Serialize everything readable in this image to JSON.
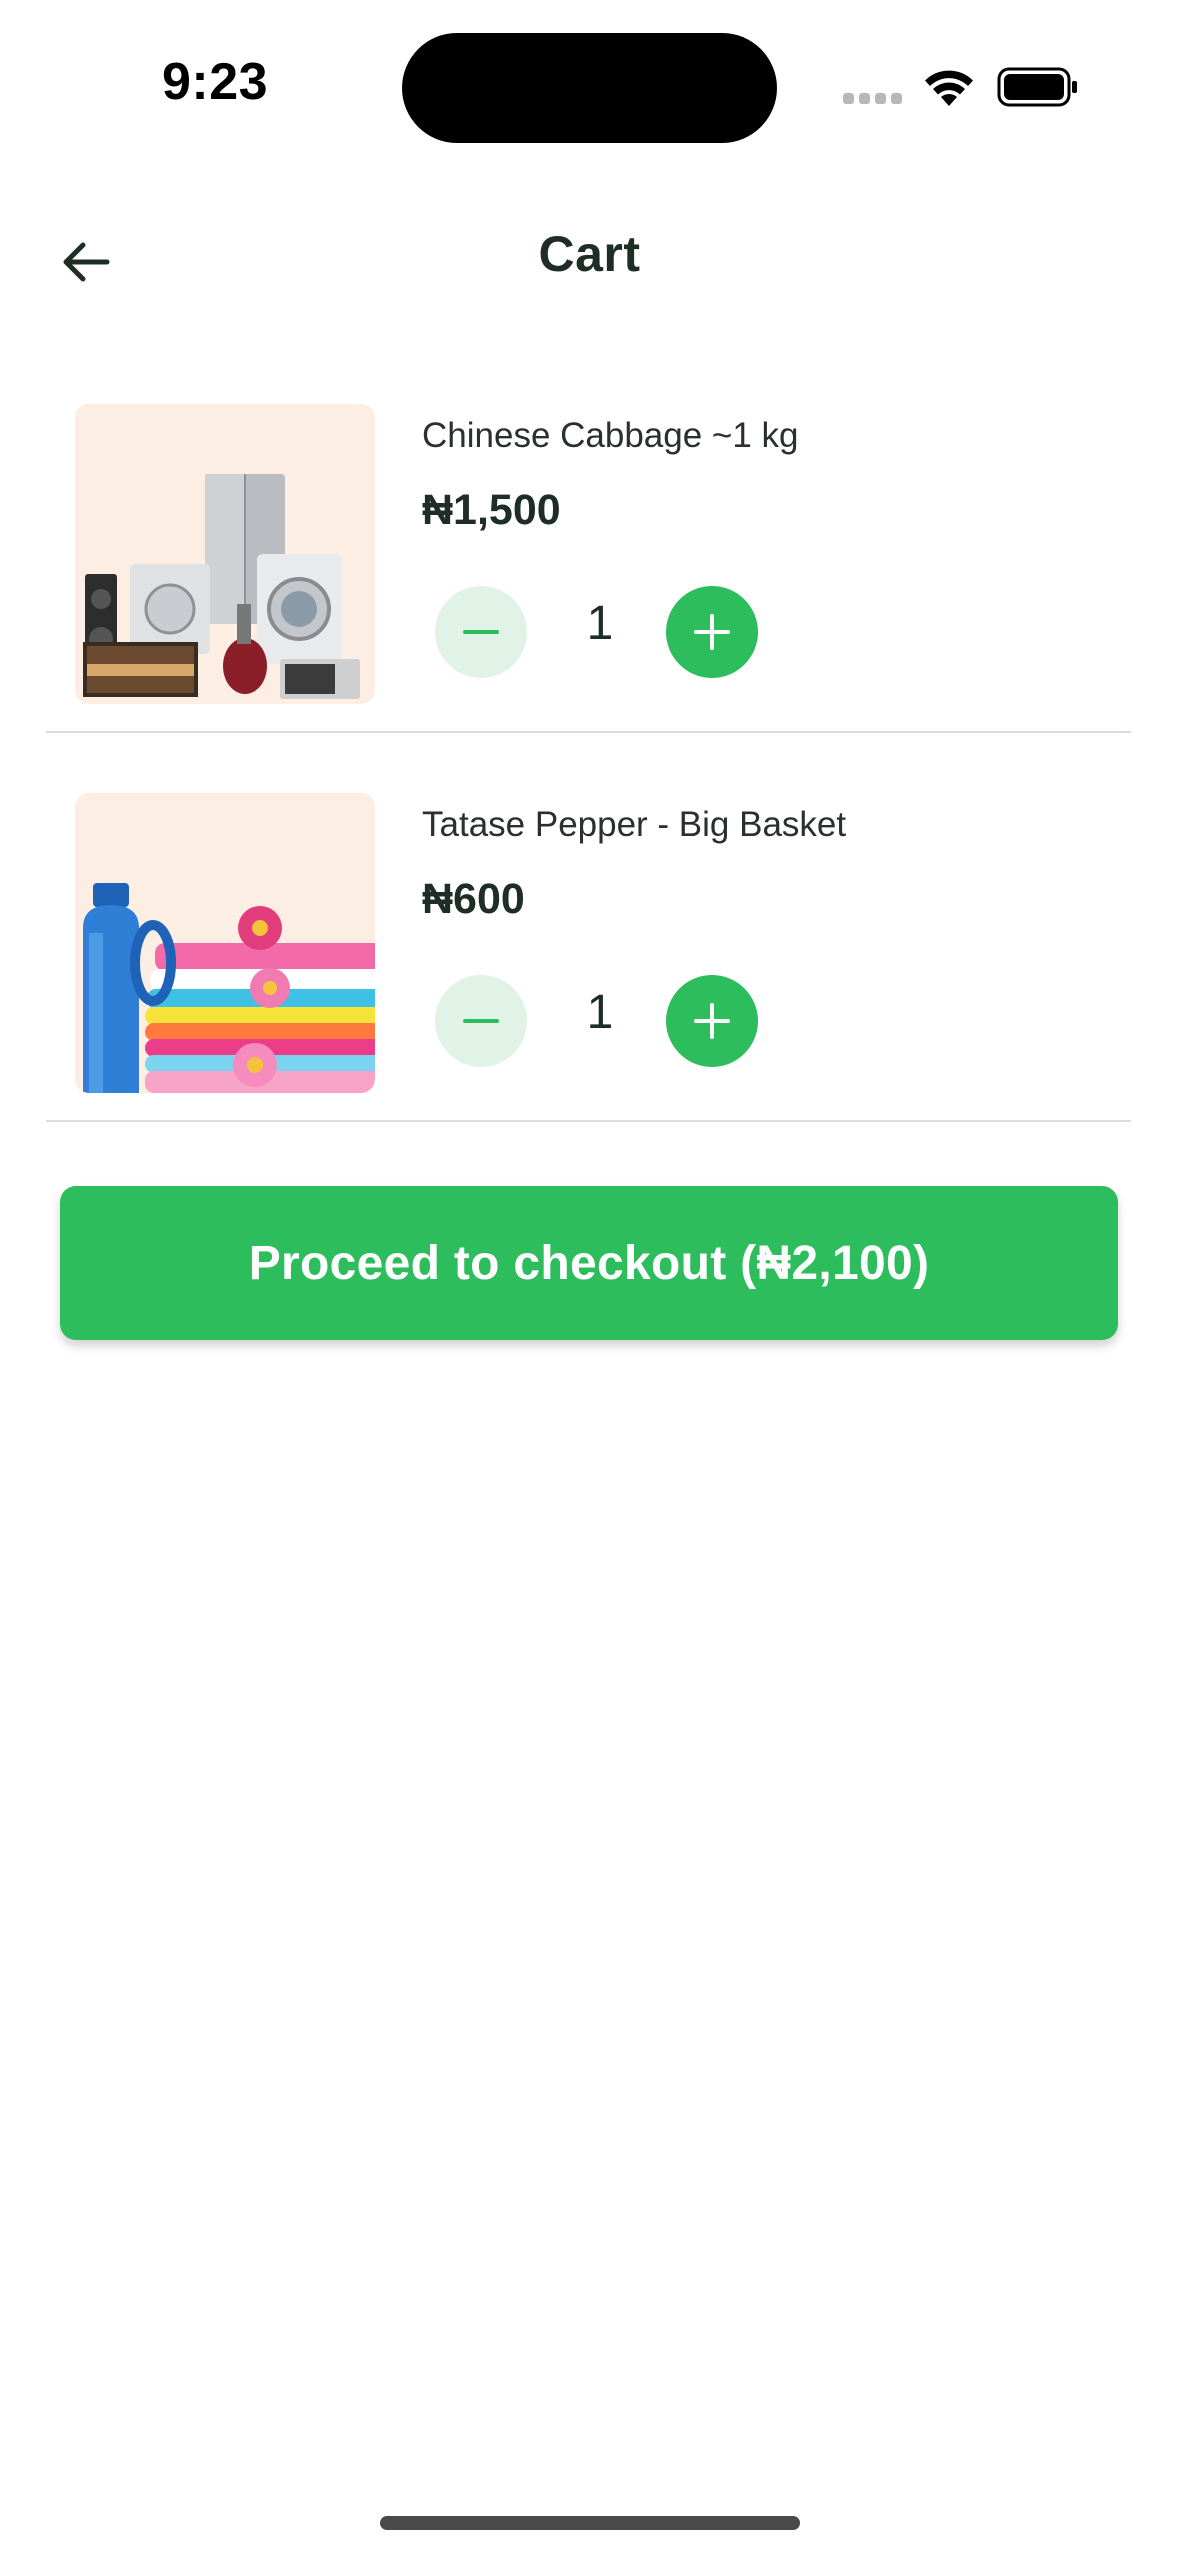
{
  "status_bar": {
    "time": "9:23"
  },
  "header": {
    "title": "Cart",
    "back_icon": "arrow-left-icon"
  },
  "cart": {
    "items": [
      {
        "name": "Chinese Cabbage ~1 kg",
        "price": "₦1,500",
        "quantity": "1",
        "image": "home-appliances-photo"
      },
      {
        "name": "Tatase Pepper - Big Basket",
        "price": "₦600",
        "quantity": "1",
        "image": "laundry-detergent-photo"
      }
    ]
  },
  "checkout": {
    "label": "Proceed to checkout (₦2,100)"
  },
  "colors": {
    "accent": "#2dbd5c",
    "accent_light": "#e1f3e6",
    "text_dark": "#1f2d27"
  }
}
